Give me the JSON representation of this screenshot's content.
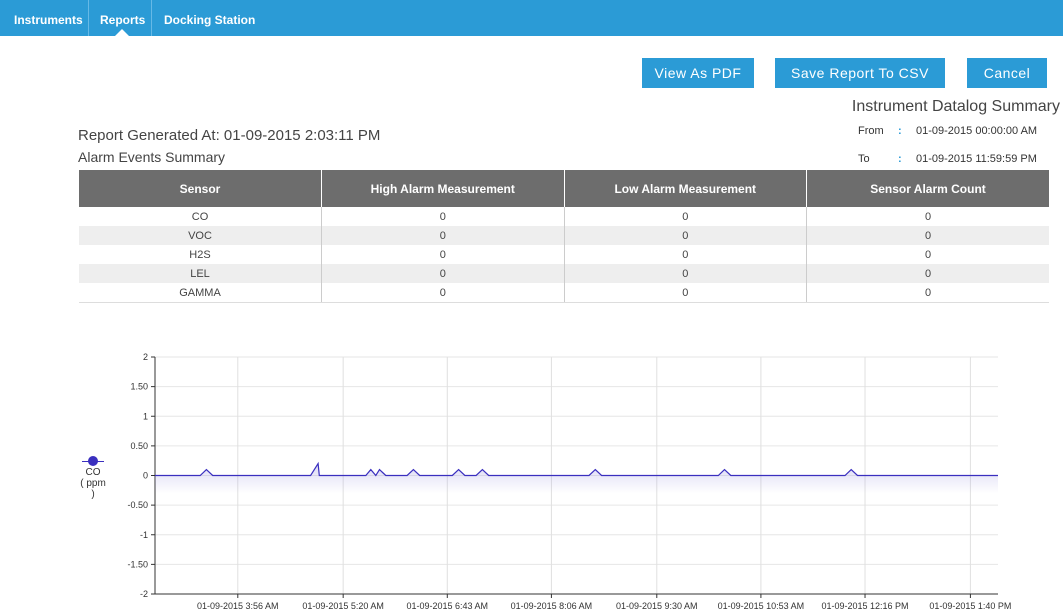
{
  "nav": {
    "tabs": [
      {
        "label": "Instruments"
      },
      {
        "label": "Reports",
        "active": true
      },
      {
        "label": "Docking Station"
      }
    ]
  },
  "actions": {
    "view_pdf": "View As PDF",
    "save_csv": "Save Report To CSV",
    "cancel": "Cancel"
  },
  "datalog": {
    "title": "Instrument Datalog Summary",
    "from_label": "From",
    "from_value": "01-09-2015 00:00:00 AM",
    "to_label": "To",
    "to_value": "01-09-2015 11:59:59 PM",
    "colon": ":"
  },
  "report": {
    "generated_at": "Report Generated At: 01-09-2015 2:03:11 PM",
    "alarm_summary_title": "Alarm Events Summary"
  },
  "alarm_table": {
    "columns": [
      "Sensor",
      "High Alarm Measurement",
      "Low Alarm Measurement",
      "Sensor Alarm Count"
    ],
    "rows": [
      [
        "CO",
        "0",
        "0",
        "0"
      ],
      [
        "VOC",
        "0",
        "0",
        "0"
      ],
      [
        "H2S",
        "0",
        "0",
        "0"
      ],
      [
        "LEL",
        "0",
        "0",
        "0"
      ],
      [
        "GAMMA",
        "0",
        "0",
        "0"
      ]
    ]
  },
  "colors": {
    "nav_bg": "#2b9bd6",
    "button_bg": "#2b9bd6",
    "table_header_bg": "#6d6d6d",
    "series_color": "#3a2fbf"
  },
  "chart_data": {
    "type": "line",
    "legend": {
      "series": "CO",
      "unit": "( ppm )"
    },
    "ylim": [
      -2,
      2
    ],
    "y_ticks": [
      "2",
      "1.50",
      "1",
      "0.50",
      "0",
      "-0.50",
      "-1",
      "-1.50",
      "-2"
    ],
    "x_ticks": [
      "01-09-2015 3:56 AM",
      "01-09-2015 5:20 AM",
      "01-09-2015 6:43 AM",
      "01-09-2015 8:06 AM",
      "01-09-2015 9:30 AM",
      "01-09-2015 10:53 AM",
      "01-09-2015 12:16 PM",
      "01-09-2015 1:40 PM"
    ],
    "x_range": [
      "01-09-2015 2:50 AM",
      "01-09-2015 2:02 PM"
    ],
    "series": [
      {
        "name": "CO",
        "points": [
          [
            "2:50 AM",
            0
          ],
          [
            "3:26 AM",
            0
          ],
          [
            "3:31 AM",
            0.1
          ],
          [
            "3:36 AM",
            0
          ],
          [
            "4:54 AM",
            0
          ],
          [
            "5:00 AM",
            0.2
          ],
          [
            "5:01 AM",
            0
          ],
          [
            "5:38 AM",
            0
          ],
          [
            "5:42 AM",
            0.1
          ],
          [
            "5:46 AM",
            0
          ],
          [
            "5:49 AM",
            0.1
          ],
          [
            "5:54 AM",
            0
          ],
          [
            "6:11 AM",
            0
          ],
          [
            "6:16 AM",
            0.1
          ],
          [
            "6:21 AM",
            0
          ],
          [
            "6:47 AM",
            0
          ],
          [
            "6:52 AM",
            0.1
          ],
          [
            "6:57 AM",
            0
          ],
          [
            "7:06 AM",
            0
          ],
          [
            "7:11 AM",
            0.1
          ],
          [
            "7:16 AM",
            0
          ],
          [
            "8:36 AM",
            0
          ],
          [
            "8:41 AM",
            0.1
          ],
          [
            "8:46 AM",
            0
          ],
          [
            "10:19 AM",
            0
          ],
          [
            "10:24 AM",
            0.1
          ],
          [
            "10:29 AM",
            0
          ],
          [
            "12:00 PM",
            0
          ],
          [
            "12:05 PM",
            0.1
          ],
          [
            "12:10 PM",
            0
          ],
          [
            "2:02 PM",
            0
          ]
        ]
      }
    ],
    "grid": true
  }
}
